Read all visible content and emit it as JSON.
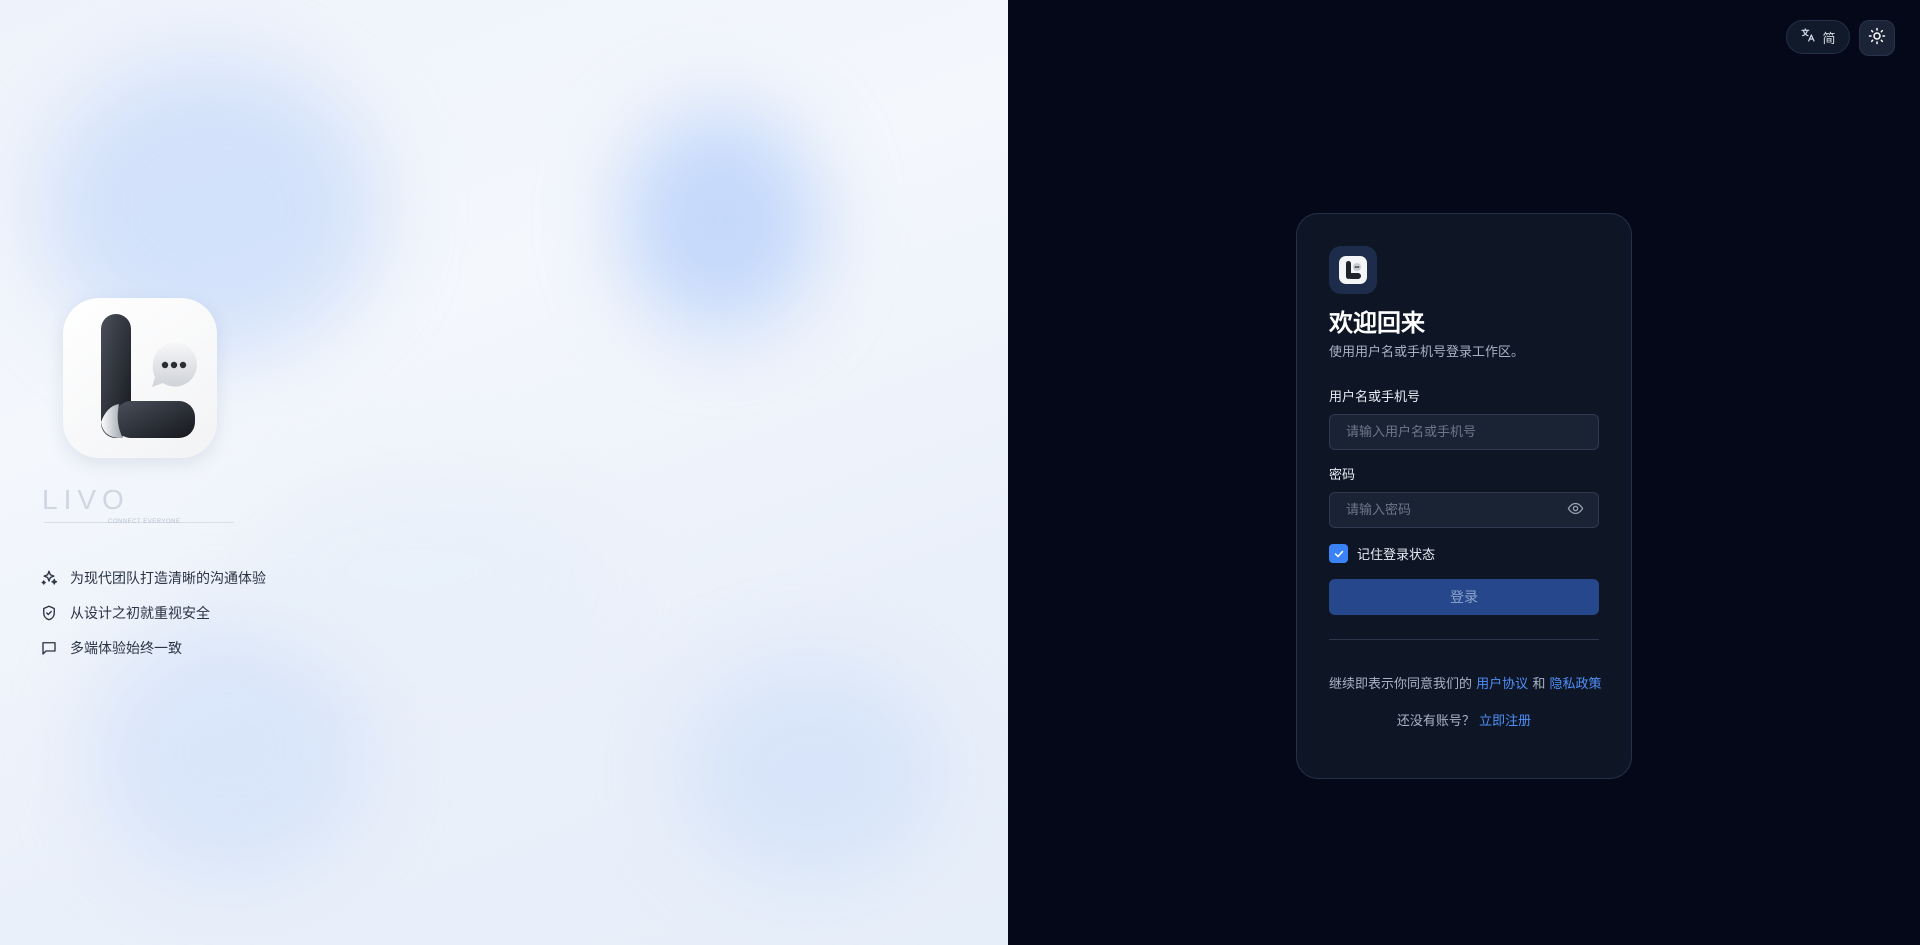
{
  "brand": {
    "wordmark": "LIVO",
    "tagline": "CONNECT EVERYONE"
  },
  "features": [
    {
      "icon": "sparkles-icon",
      "label": "为现代团队打造清晰的沟通体验"
    },
    {
      "icon": "shield-check-icon",
      "label": "从设计之初就重视安全"
    },
    {
      "icon": "message-square-icon",
      "label": "多端体验始终一致"
    }
  ],
  "top_controls": {
    "language_label": "简",
    "language_icon": "translate-icon",
    "theme_icon": "sun-icon"
  },
  "login": {
    "title": "欢迎回来",
    "subtitle": "使用用户名或手机号登录工作区。",
    "username": {
      "label": "用户名或手机号",
      "placeholder": "请输入用户名或手机号",
      "value": ""
    },
    "password": {
      "label": "密码",
      "placeholder": "请输入密码",
      "value": "",
      "toggle_icon": "eye-icon"
    },
    "remember": {
      "label": "记住登录状态",
      "checked": true
    },
    "submit_label": "登录",
    "agreement": {
      "prefix": "继续即表示你同意我们的",
      "terms": "用户协议",
      "and": "和",
      "privacy": "隐私政策"
    },
    "register": {
      "prompt": "还没有账号？",
      "link": "立即注册"
    }
  },
  "colors": {
    "accent": "#3b82f6",
    "link": "#4f8ff7",
    "right_background": "#050818",
    "card_background": "#0e1626",
    "button_background": "#26478b"
  }
}
